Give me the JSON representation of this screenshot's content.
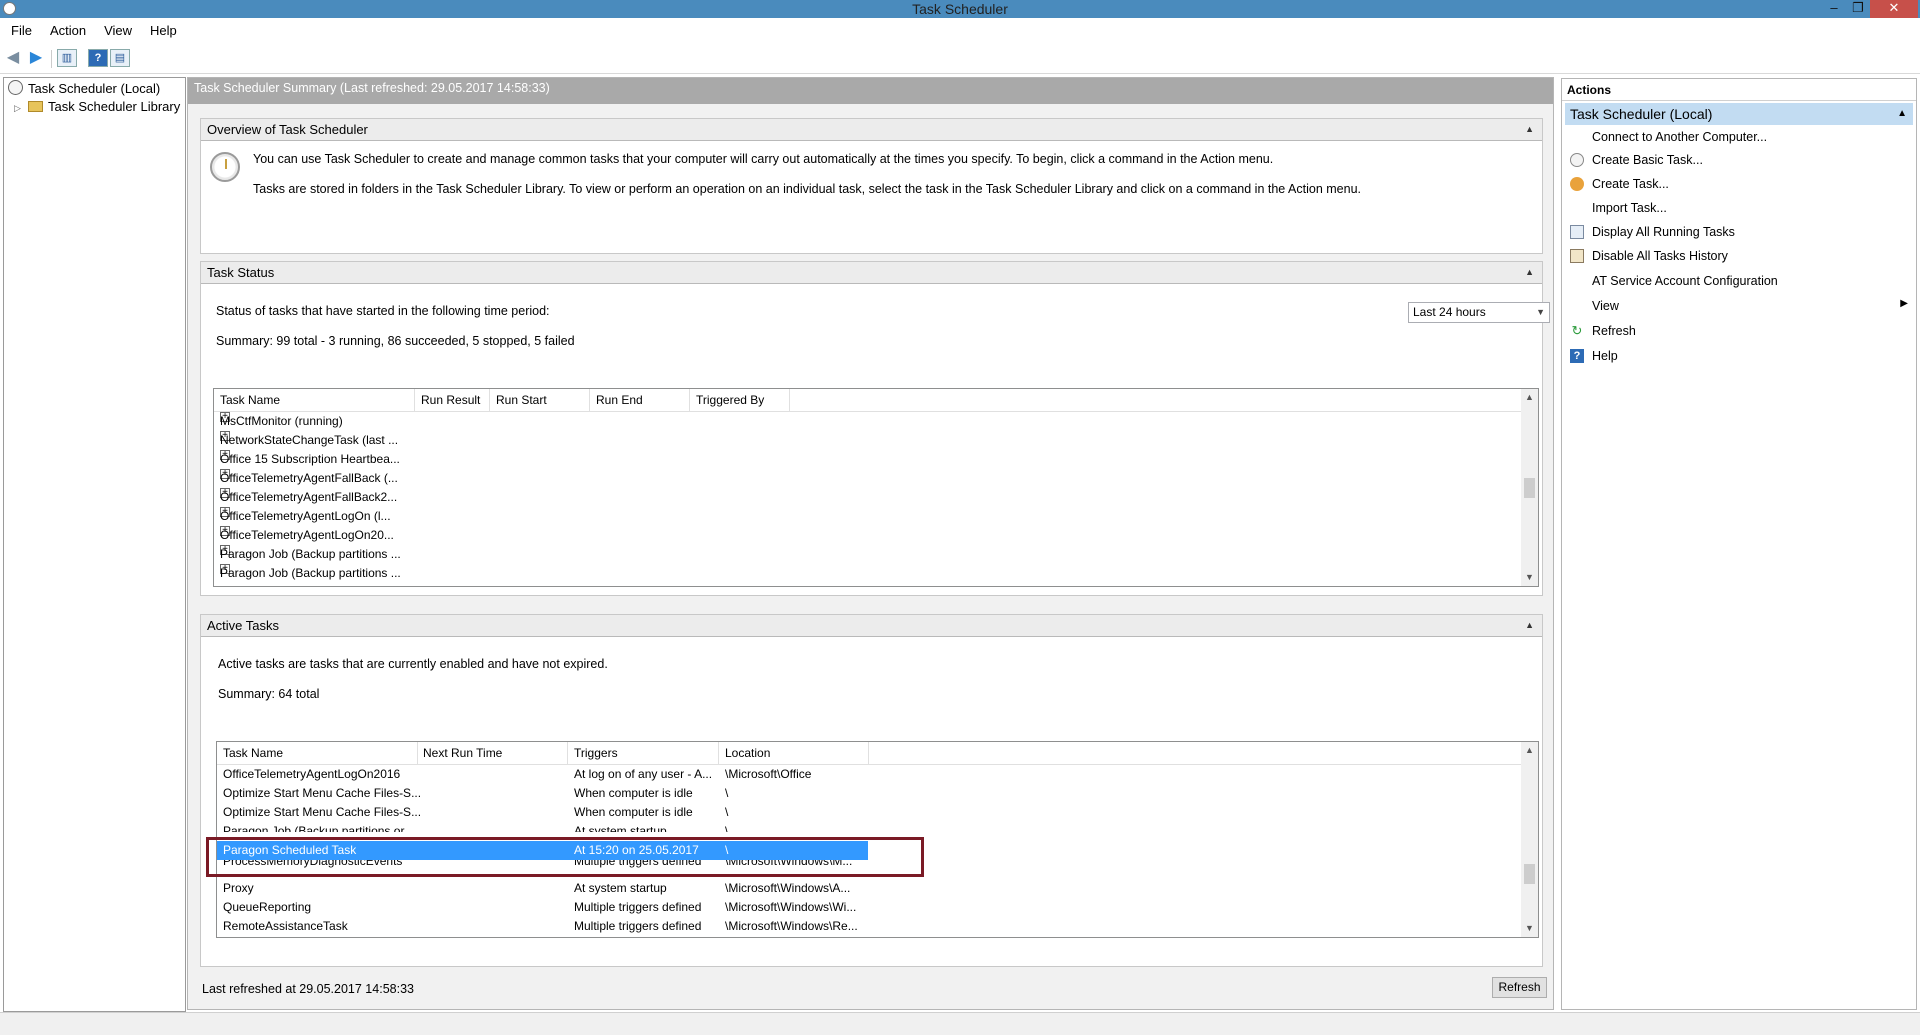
{
  "window": {
    "title": "Task Scheduler",
    "min": "–",
    "max": "❐",
    "close": "✕"
  },
  "menu": [
    "File",
    "Action",
    "View",
    "Help"
  ],
  "tree": {
    "root": "Task Scheduler (Local)",
    "library": "Task Scheduler Library"
  },
  "center": {
    "header": "Task Scheduler Summary (Last refreshed: 29.05.2017 14:58:33)",
    "overview": {
      "title": "Overview of Task Scheduler",
      "line1": "You can use Task Scheduler to create and manage common tasks that your computer will carry out automatically at the times you specify. To begin, click a command in the Action menu.",
      "line2": "Tasks are stored in folders in the Task Scheduler Library. To view or perform an operation on an individual task, select the task in the Task Scheduler Library and click on a command in the Action menu."
    },
    "status": {
      "title": "Task Status",
      "period_label": "Status of tasks that have started in the following time period:",
      "period_value": "Last 24 hours",
      "summary": "Summary: 99 total - 3 running, 86 succeeded, 5 stopped, 5 failed",
      "columns": [
        "Task Name",
        "Run Result",
        "Run Start",
        "Run End",
        "Triggered By"
      ],
      "rows": [
        "MsCtfMonitor (running)",
        "NetworkStateChangeTask (last ...",
        "Office 15 Subscription Heartbea...",
        "OfficeTelemetryAgentFallBack (...",
        "OfficeTelemetryAgentFallBack2...",
        "OfficeTelemetryAgentLogOn (l...",
        "OfficeTelemetryAgentLogOn20...",
        "Paragon Job (Backup partitions ...",
        "Paragon Job (Backup partitions ..."
      ]
    },
    "active": {
      "title": "Active Tasks",
      "description": "Active tasks are tasks that are currently enabled and have not expired.",
      "summary": "Summary: 64 total",
      "columns": [
        "Task Name",
        "Next Run Time",
        "Triggers",
        "Location"
      ],
      "rows": [
        {
          "name": "OfficeTelemetryAgentLogOn2016",
          "next": "",
          "triggers": "At log on of any user - A...",
          "location": "\\Microsoft\\Office"
        },
        {
          "name": "Optimize Start Menu Cache Files-S...",
          "next": "",
          "triggers": "When computer is idle",
          "location": "\\"
        },
        {
          "name": "Optimize Start Menu Cache Files-S...",
          "next": "",
          "triggers": "When computer is idle",
          "location": "\\"
        },
        {
          "name": "Paragon Job (Backup partitions or...",
          "next": "",
          "triggers": "At system startup",
          "location": "\\"
        },
        {
          "name": "Paragon Scheduled Task",
          "next": "",
          "triggers": "At 15:20 on 25.05.2017",
          "location": "\\"
        },
        {
          "name": "ProcessMemoryDiagnosticEvents",
          "next": "",
          "triggers": "Multiple triggers defined",
          "location": "\\Microsoft\\Windows\\M..."
        },
        {
          "name": "Proxy",
          "next": "",
          "triggers": "At system startup",
          "location": "\\Microsoft\\Windows\\A..."
        },
        {
          "name": "QueueReporting",
          "next": "",
          "triggers": "Multiple triggers defined",
          "location": "\\Microsoft\\Windows\\Wi..."
        },
        {
          "name": "RemoteAssistanceTask",
          "next": "",
          "triggers": "Multiple triggers defined",
          "location": "\\Microsoft\\Windows\\Re..."
        }
      ]
    },
    "footer": {
      "last_refreshed": "Last refreshed at 29.05.2017 14:58:33",
      "refresh_button": "Refresh"
    }
  },
  "actions": {
    "header": "Actions",
    "group": "Task Scheduler (Local)",
    "items": [
      {
        "label": "Connect to Another Computer...",
        "icon": ""
      },
      {
        "label": "Create Basic Task...",
        "icon": "create-basic-task-icon"
      },
      {
        "label": "Create Task...",
        "icon": "create-task-icon"
      },
      {
        "label": "Import Task...",
        "icon": ""
      },
      {
        "label": "Display All Running Tasks",
        "icon": "running-tasks-icon"
      },
      {
        "label": "Disable All Tasks History",
        "icon": "history-icon"
      },
      {
        "label": "AT Service Account Configuration",
        "icon": ""
      },
      {
        "label": "View",
        "icon": ""
      },
      {
        "label": "Refresh",
        "icon": "refresh-icon"
      },
      {
        "label": "Help",
        "icon": "help-icon"
      }
    ]
  },
  "colors": {
    "titlebar": "#4a8bbd",
    "selection": "#3399ff",
    "highlight_box": "#7a1a25",
    "actions_group": "#c2dcf2"
  }
}
